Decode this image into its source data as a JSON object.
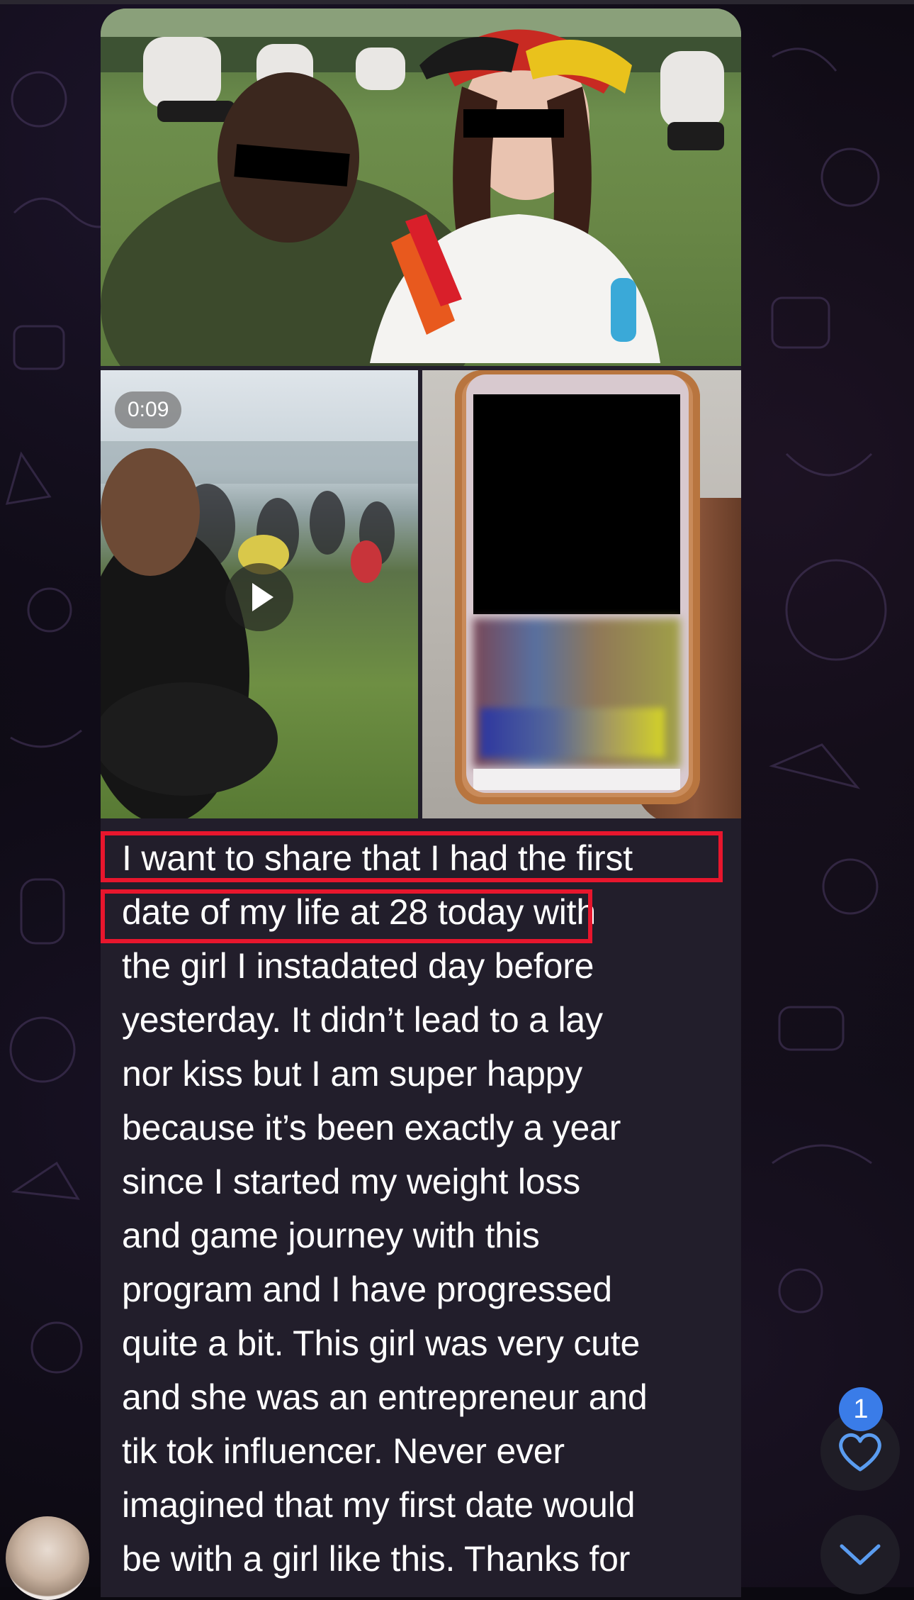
{
  "message": {
    "video_duration": "0:09",
    "caption_lines": [
      "I want to share that I had the first",
      "date of my life at 28 today with",
      "the girl I instadated day before",
      "yesterday. It didn’t lead to a lay",
      "nor kiss but I am super happy",
      "because it’s been exactly a year",
      "since I started my weight loss",
      "and game journey with this",
      "program and I have progressed",
      "quite a bit. This girl was very cute",
      "and she was an entrepreneur and",
      "tik tok influencer. Never ever",
      "imagined that my first date would",
      "be with a girl like this. Thanks for"
    ]
  },
  "reactions": {
    "count": "1",
    "icon": "heart-icon"
  },
  "colors": {
    "highlight": "#e8162d",
    "badge": "#3a7ce8",
    "bubble": "#221e2b",
    "accent_icon": "#5a9cf0"
  }
}
